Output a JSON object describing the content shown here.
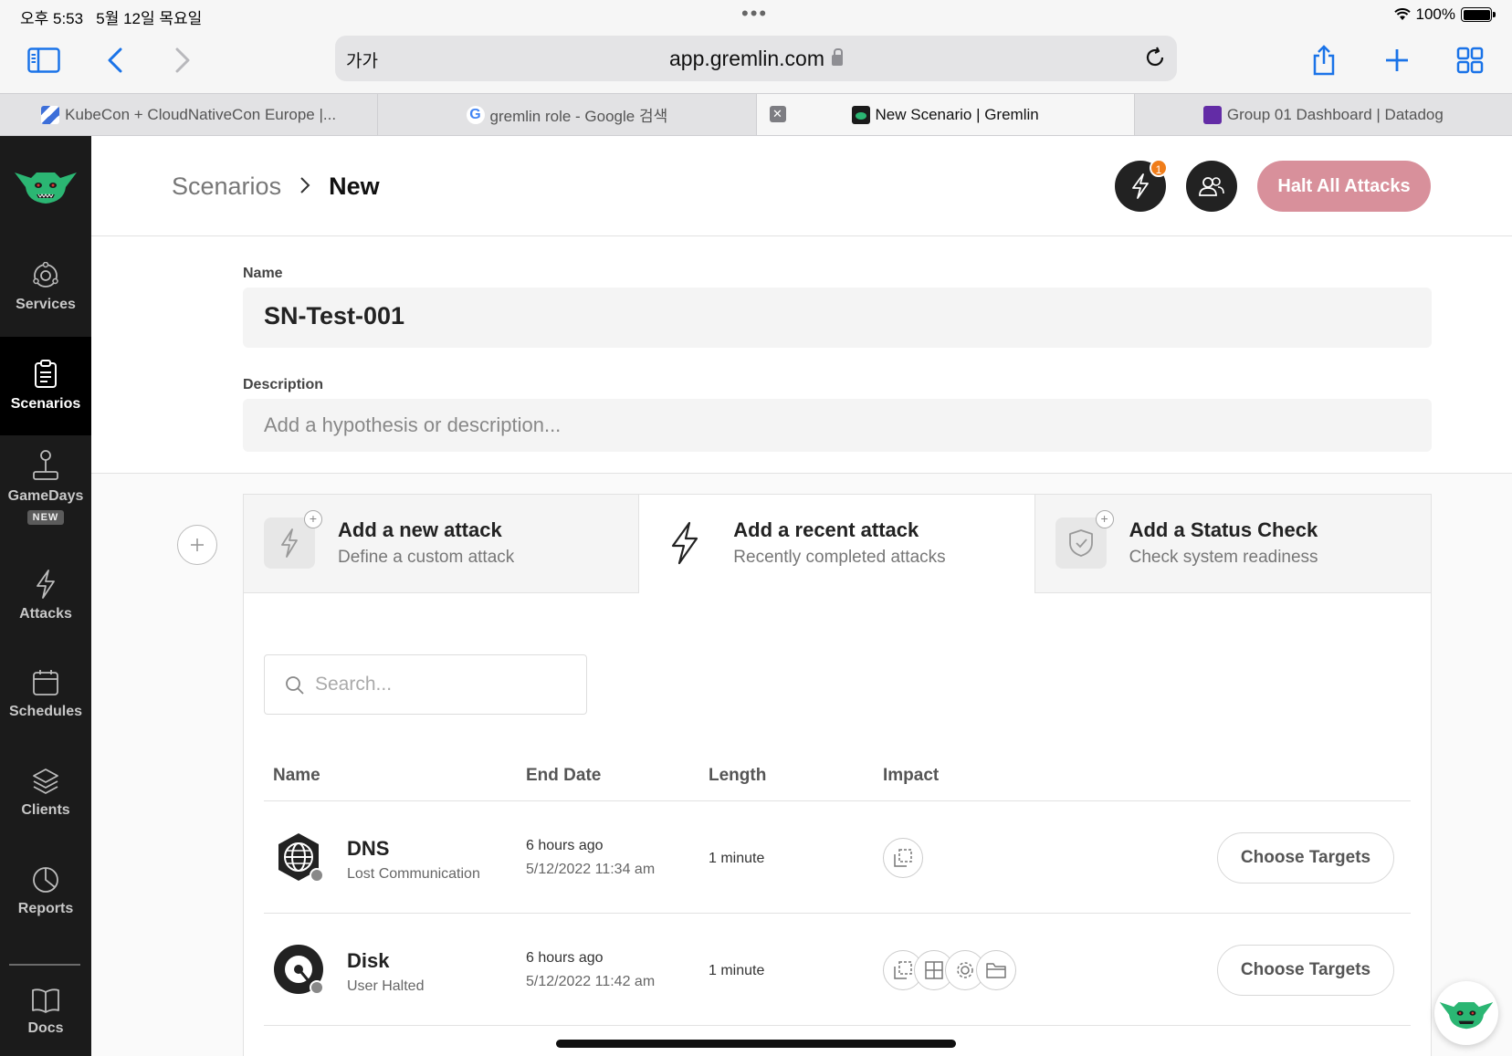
{
  "status_bar": {
    "time": "오후 5:53",
    "date": "5월 12일 목요일",
    "battery": "100%"
  },
  "browser": {
    "text_size_label": "가가",
    "url": "app.gremlin.com",
    "tabs": [
      {
        "label": "KubeCon + CloudNativeCon Europe |...",
        "favicon": "kubecon-favicon"
      },
      {
        "label": "gremlin role - Google 검색",
        "favicon": "google-favicon"
      },
      {
        "label": "New Scenario | Gremlin",
        "favicon": "gremlin-favicon",
        "active": true
      },
      {
        "label": "Group 01 Dashboard | Datadog",
        "favicon": "datadog-favicon"
      }
    ]
  },
  "sidebar": {
    "items": [
      {
        "label": "Services",
        "icon": "services-icon"
      },
      {
        "label": "Scenarios",
        "icon": "clipboard-icon",
        "active": true
      },
      {
        "label": "GameDays",
        "icon": "joystick-icon",
        "badge": "NEW"
      },
      {
        "label": "Attacks",
        "icon": "lightning-icon"
      },
      {
        "label": "Schedules",
        "icon": "calendar-icon"
      },
      {
        "label": "Clients",
        "icon": "layers-icon"
      },
      {
        "label": "Reports",
        "icon": "pie-chart-icon"
      },
      {
        "label": "Docs",
        "icon": "book-icon"
      }
    ]
  },
  "header": {
    "breadcrumb_parent": "Scenarios",
    "breadcrumb_current": "New",
    "notification_count": "1",
    "halt_label": "Halt All Attacks"
  },
  "form": {
    "name_label": "Name",
    "name_value": "SN-Test-001",
    "description_label": "Description",
    "description_placeholder": "Add a hypothesis or description..."
  },
  "options": [
    {
      "title": "Add a new attack",
      "subtitle": "Define a custom attack"
    },
    {
      "title": "Add a recent attack",
      "subtitle": "Recently completed attacks"
    },
    {
      "title": "Add a Status Check",
      "subtitle": "Check system readiness"
    }
  ],
  "search": {
    "placeholder": "Search..."
  },
  "table": {
    "columns": [
      "Name",
      "End Date",
      "Length",
      "Impact"
    ],
    "rows": [
      {
        "name": "DNS",
        "status": "Lost Communication",
        "end_relative": "6 hours ago",
        "end_absolute": "5/12/2022 11:34 am",
        "length": "1 minute",
        "impact": [
          "container-icon"
        ],
        "action": "Choose Targets"
      },
      {
        "name": "Disk",
        "status": "User Halted",
        "end_relative": "6 hours ago",
        "end_absolute": "5/12/2022 11:42 am",
        "length": "1 minute",
        "impact": [
          "container-icon",
          "grid-icon",
          "gear-icon",
          "folder-icon"
        ],
        "action": "Choose Targets"
      }
    ]
  },
  "colors": {
    "sidebar_bg": "#1b1b1b",
    "halt_button": "#d8909b",
    "badge": "#f07d1a",
    "brand_green": "#2bb673"
  }
}
